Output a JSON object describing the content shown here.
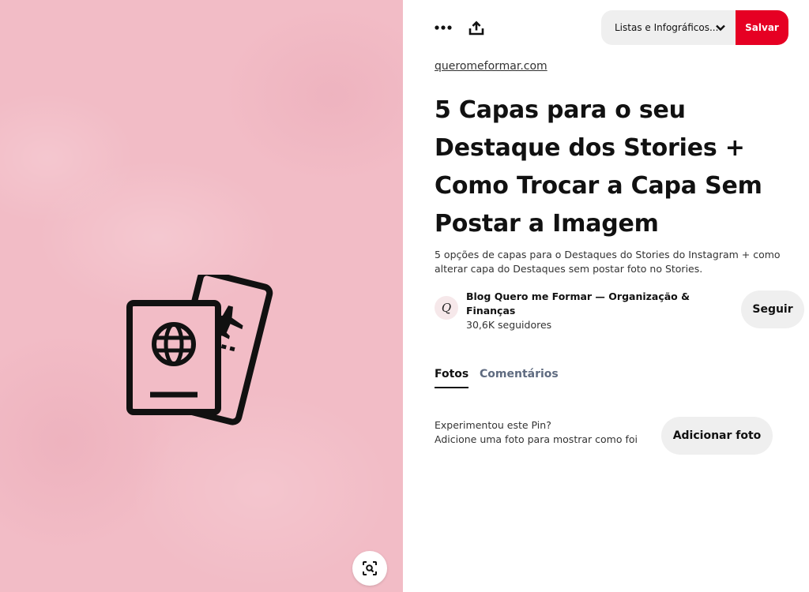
{
  "pin": {
    "source": "queromeformar.com",
    "title": "5 Capas para o seu Destaque dos Stories + Como Trocar a Capa Sem Postar a Imagem",
    "description": "5 opções de capas para o Destaques do Stories do Instagram + como alterar capa do Destaques sem postar foto no Stories.",
    "image_background": "#f2bcc6"
  },
  "toolbar": {
    "more_icon": "more-options-icon",
    "share_icon": "share-icon",
    "board": "Listas e Infográficos...",
    "save_label": "Salvar",
    "save_color": "#e60023"
  },
  "creator": {
    "avatar_letter": "Q",
    "name": "Blog Quero me Formar — Organização & Finanças",
    "followers": "30,6K seguidores",
    "follow_label": "Seguir"
  },
  "tabs": [
    {
      "label": "Fotos",
      "active": true
    },
    {
      "label": "Comentários",
      "active": false
    }
  ],
  "tried": {
    "line1": "Experimentou este Pin?",
    "line2": "Adicione uma foto para mostrar como foi",
    "add_photo_label": "Adicionar foto"
  },
  "image_tools": {
    "lens_icon": "visual-search-icon"
  }
}
